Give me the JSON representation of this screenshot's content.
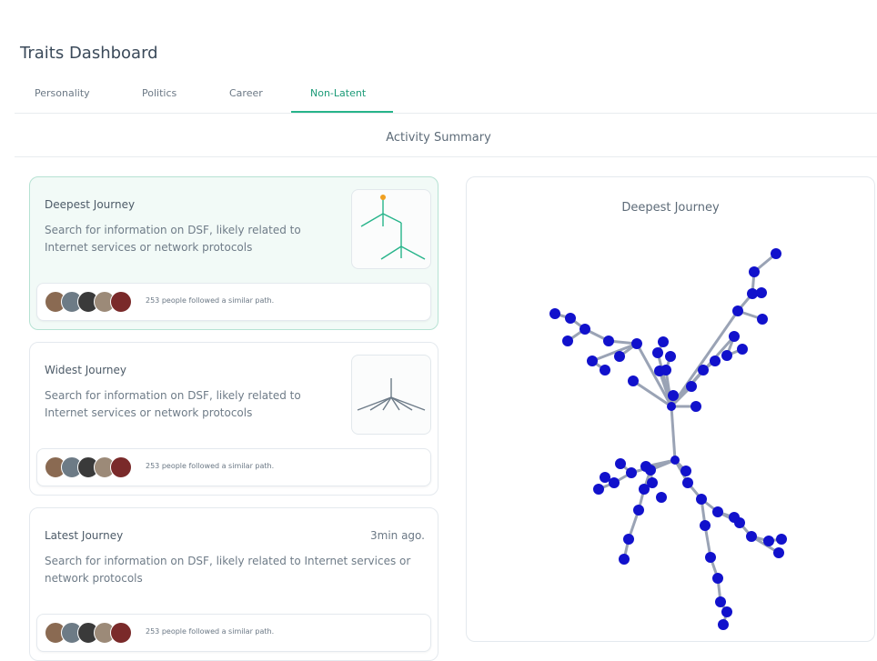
{
  "header": {
    "title": "Traits Dashboard"
  },
  "tabs": [
    {
      "label": "Personality"
    },
    {
      "label": "Politics"
    },
    {
      "label": "Career"
    },
    {
      "label": "Non-Latent",
      "active": true
    }
  ],
  "section_title": "Activity Summary",
  "cards": [
    {
      "title": "Deepest Journey",
      "description": "Search for information on DSF, likely related to Internet services or network protocols",
      "follow_text": "253 people followed a similar path.",
      "thumbnail_icon": "deep-tree-icon"
    },
    {
      "title": "Widest Journey",
      "description": "Search for information on DSF, likely related to Internet services or network protocols",
      "follow_text": "253 people followed a similar path.",
      "thumbnail_icon": "wide-tree-icon"
    },
    {
      "title": "Latest Journey",
      "meta": "3min ago.",
      "description": "Search for information on DSF, likely related to Internet services or network protocols",
      "follow_text": "253 people followed a similar path."
    }
  ],
  "graph_panel": {
    "title": "Deepest Journey"
  },
  "colors": {
    "accent": "#27b48a",
    "node": "#1111cc",
    "active_card_bg": "#f2faf7",
    "thumb_root": "#f0a020"
  }
}
